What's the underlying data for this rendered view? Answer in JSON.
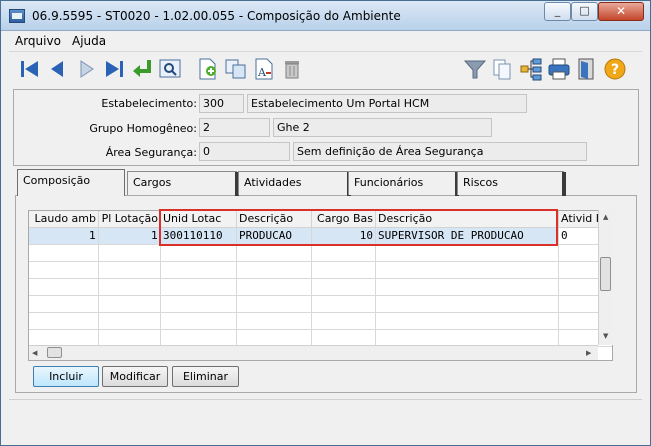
{
  "window": {
    "title": "06.9.5595 - ST0020 - 1.02.00.055 - Composição do Ambiente"
  },
  "menu": [
    "Arquivo",
    "Ajuda"
  ],
  "toolbar": {
    "icons": [
      "first-icon",
      "prev-icon",
      "next-icon",
      "last-icon",
      "enter-icon",
      "zoom-icon",
      "new-doc-icon",
      "copy-icon",
      "text-format-icon",
      "delete-icon",
      "filter-icon",
      "pages-icon",
      "tree-icon",
      "print-icon",
      "exit-icon",
      "help-icon"
    ]
  },
  "form": {
    "estabelecimento": {
      "label": "Estabelecimento:",
      "code": "300",
      "desc": "Estabelecimento Um Portal HCM"
    },
    "grupo": {
      "label": "Grupo Homogêneo:",
      "code": "2",
      "desc": "Ghe 2"
    },
    "area": {
      "label": "Área Segurança:",
      "code": "0",
      "desc": "Sem definição de Área Segurança"
    }
  },
  "tabs": [
    "Composição",
    "Cargos",
    "Atividades",
    "Funcionários",
    "Riscos"
  ],
  "grid": {
    "columns": [
      "Laudo amb",
      "Pl Lotação",
      "Unid Lotac",
      "Descrição",
      "Cargo Bas",
      "Descrição",
      "Ativid Fu"
    ],
    "rows": [
      [
        "1",
        "1",
        "300110110",
        "PRODUCAO",
        "10",
        "SUPERVISOR DE PRODUCAO",
        "0"
      ]
    ]
  },
  "buttons": {
    "incluir": "Incluir",
    "modificar": "Modificar",
    "eliminar": "Eliminar"
  },
  "colors": {
    "highlight": "#d9302a",
    "selection": "#d7e6f5"
  }
}
